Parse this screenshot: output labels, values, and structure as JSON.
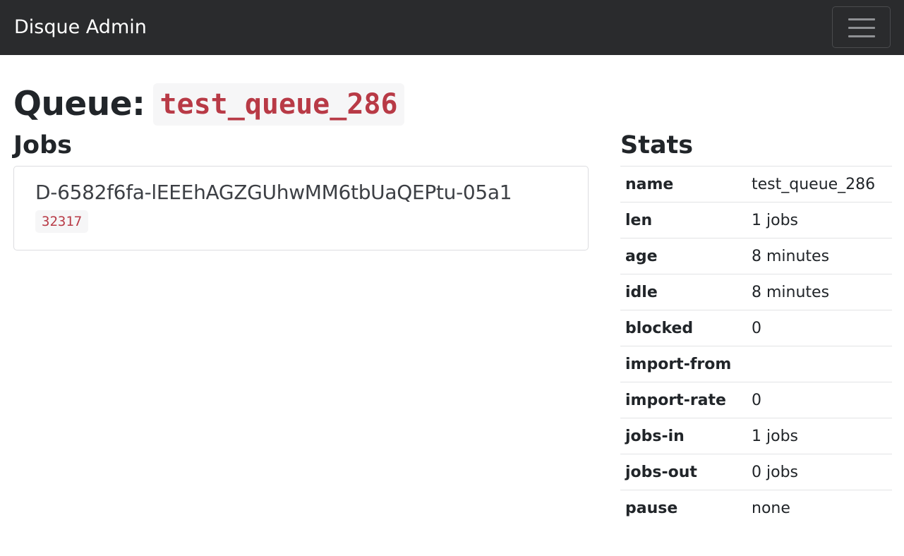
{
  "navbar": {
    "brand": "Disque Admin",
    "toggle_icon": "hamburger-menu-icon"
  },
  "page": {
    "title_label": "Queue:",
    "queue_name": "test_queue_286"
  },
  "jobs": {
    "heading": "Jobs",
    "items": [
      {
        "id": "D-6582f6fa-lEEEhAGZGUhwMM6tbUaQEPtu-05a1",
        "badge": "32317"
      }
    ]
  },
  "stats": {
    "heading": "Stats",
    "rows": [
      {
        "key": "name",
        "value": "test_queue_286"
      },
      {
        "key": "len",
        "value": "1 jobs"
      },
      {
        "key": "age",
        "value": "8 minutes"
      },
      {
        "key": "idle",
        "value": "8 minutes"
      },
      {
        "key": "blocked",
        "value": "0"
      },
      {
        "key": "import-from",
        "value": ""
      },
      {
        "key": "import-rate",
        "value": "0"
      },
      {
        "key": "jobs-in",
        "value": "1 jobs"
      },
      {
        "key": "jobs-out",
        "value": "0 jobs"
      },
      {
        "key": "pause",
        "value": "none"
      }
    ]
  },
  "colors": {
    "navbar_bg": "#2a2b2d",
    "code_text": "#b83a46",
    "code_bg": "#f6f6f7"
  }
}
